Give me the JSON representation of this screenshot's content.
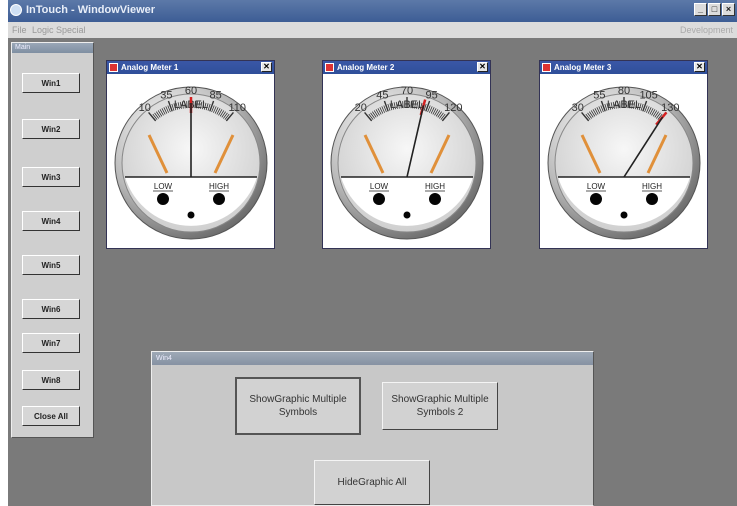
{
  "window": {
    "title": "InTouch - WindowViewer"
  },
  "menu": {
    "items": [
      "File",
      "Logic",
      "Special"
    ],
    "status": "Development"
  },
  "main_panel": {
    "title": "Main",
    "buttons": [
      "Win1",
      "Win2",
      "Win3",
      "Win4",
      "Win5",
      "Win6",
      "Win7",
      "Win8",
      "Close All"
    ]
  },
  "meters": [
    {
      "title": "Analog Meter 1",
      "label": "LABEL",
      "scale": [
        "10",
        "35",
        "60",
        "85",
        "110"
      ],
      "low": "LOW",
      "high": "HIGH",
      "value": 60
    },
    {
      "title": "Analog Meter 2",
      "label": "LABEL",
      "scale": [
        "20",
        "45",
        "70",
        "95",
        "120"
      ],
      "low": "LOW",
      "high": "HIGH",
      "value": 90
    },
    {
      "title": "Analog Meter 3",
      "label": "LABEL",
      "scale": [
        "30",
        "55",
        "80",
        "105",
        "130"
      ],
      "low": "LOW",
      "high": "HIGH",
      "value": 130
    }
  ],
  "colors": {
    "needle_red": "#d42020",
    "needle_black": "#222222",
    "limit_orange": "#e0903a",
    "panel_bg": "#7a7a7a"
  },
  "win4": {
    "title": "Win4",
    "show_multiple": "ShowGraphic Multiple Symbols",
    "show_multiple_2": "ShowGraphic Multiple Symbols 2",
    "hide_all": "HideGraphic All"
  }
}
